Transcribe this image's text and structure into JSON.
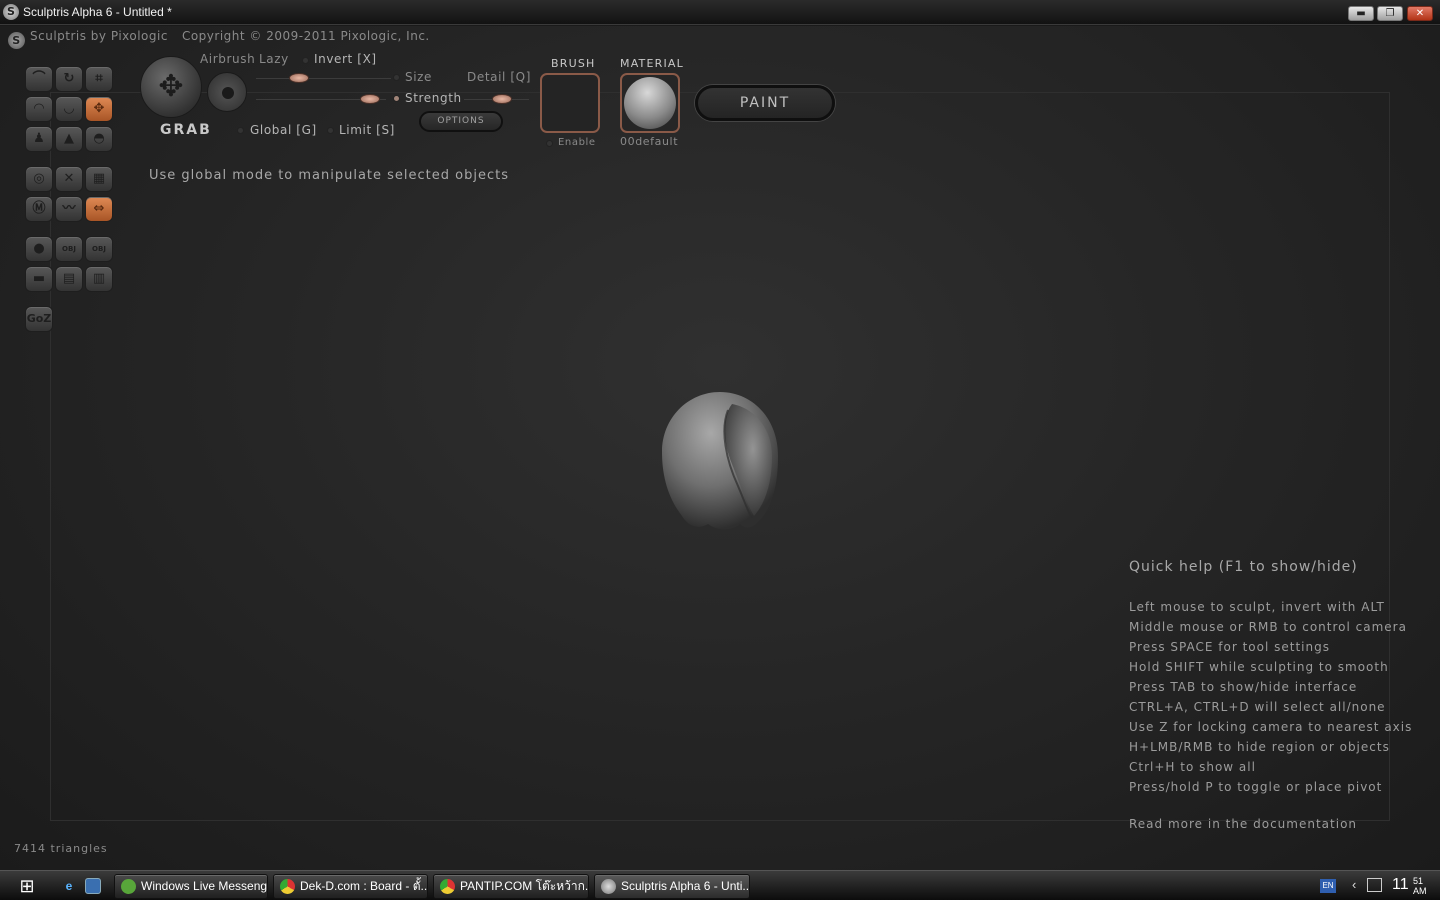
{
  "window": {
    "title": "Sculptris Alpha 6 - Untitled *",
    "minimize_label": "▬",
    "maximize_label": "❐",
    "close_label": "✕"
  },
  "brand": {
    "logo_glyph": "S",
    "name": "Sculptris by Pixologic",
    "copyright": "Copyright © 2009-2011 Pixologic, Inc."
  },
  "tools": {
    "goz_label": "GoZ",
    "obj_label": "OBJ"
  },
  "brush": {
    "name": "GRAB",
    "airbrush_label": "Airbrush",
    "lazy_label": "Lazy",
    "invert_label": "Invert [X]",
    "size_label": "Size",
    "detail_label": "Detail [Q]",
    "strength_label": "Strength",
    "global_label": "Global [G]",
    "limit_label": "Limit [S]",
    "options_label": "OPTIONS",
    "hint": "Use global mode to manipulate selected objects"
  },
  "brush_swatch": {
    "title": "BRUSH",
    "enable_label": "Enable"
  },
  "material_swatch": {
    "title": "MATERIAL",
    "name": "00default"
  },
  "paint_label": "PAINT",
  "quickhelp": {
    "title": "Quick help (F1 to show/hide)",
    "lines": [
      "Left mouse to sculpt, invert with ALT",
      "Middle mouse or RMB to control camera",
      "Press SPACE for tool settings",
      "Hold SHIFT while sculpting to smooth",
      "Press TAB to show/hide interface",
      "CTRL+A, CTRL+D will select all/none",
      "Use Z for locking camera to nearest axis",
      "H+LMB/RMB to hide region or objects",
      "Ctrl+H to show all",
      "Press/hold P to toggle or place pivot"
    ],
    "more": "Read more in the documentation"
  },
  "status": {
    "triangles": "7414 triangles"
  },
  "taskbar": {
    "tasks": [
      {
        "label": "Windows Live Messenger",
        "color": "#58a63a"
      },
      {
        "label": "Dek-D.com : Board - ตั้...",
        "color": "#e0b020"
      },
      {
        "label": "PANTIP.COM โต๊ะหว้าก...",
        "color": "#d94a2a"
      },
      {
        "label": "Sculptris Alpha 6 - Unti...",
        "color": "#bbbbbb"
      }
    ],
    "lang": "EN",
    "clock_hour": "11",
    "clock_min": "51",
    "clock_ampm": "AM"
  },
  "colors": {
    "accent_orange": "#e08a55",
    "knob": "#d9a793",
    "background": "#262626"
  }
}
